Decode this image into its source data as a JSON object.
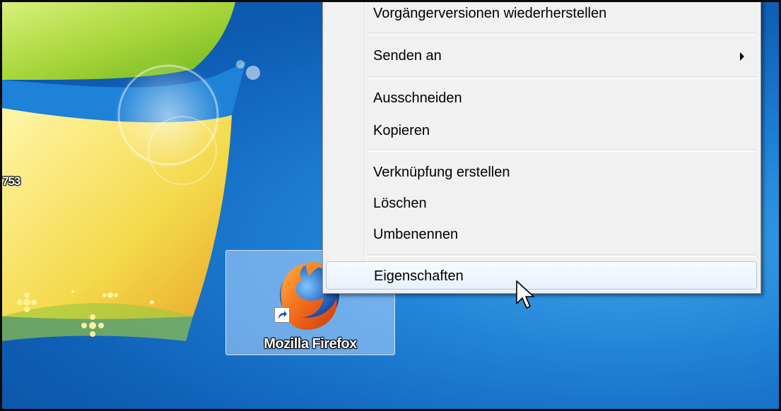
{
  "desktop": {
    "left_label": "753",
    "shortcut": {
      "label": "Mozilla Firefox",
      "icon": "firefox-icon",
      "overlay_icon": "shortcut-arrow-icon"
    }
  },
  "context_menu": {
    "items": [
      {
        "label": "Vorgängerversionen wiederherstellen"
      },
      {
        "label": "Senden an",
        "submenu": true
      },
      {
        "label": "Ausschneiden"
      },
      {
        "label": "Kopieren"
      },
      {
        "label": "Verknüpfung erstellen"
      },
      {
        "label": "Löschen"
      },
      {
        "label": "Umbenennen"
      },
      {
        "label": "Eigenschaften",
        "highlighted": true
      }
    ]
  },
  "colors": {
    "desktop_blue": "#1e7fd4",
    "menu_bg": "#f1f1f1",
    "highlight_border": "#a8c8ea",
    "selection_bg": "#b4d7ff"
  }
}
